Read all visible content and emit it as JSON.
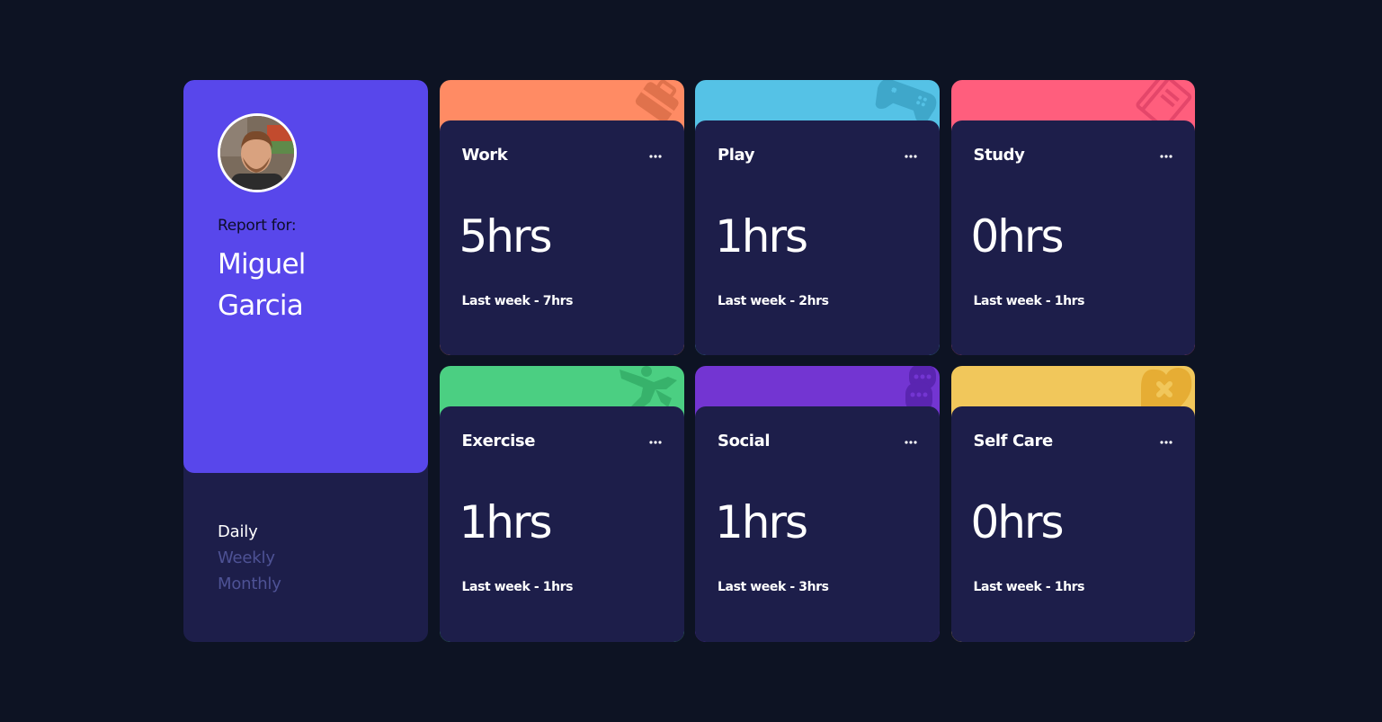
{
  "profile": {
    "report_label": "Report for:",
    "name": "Miguel Garcia",
    "timeframes": [
      "Daily",
      "Weekly",
      "Monthly"
    ],
    "active_timeframe": "Daily"
  },
  "cards": [
    {
      "title": "Work",
      "current": "5hrs",
      "previous": "Last week - 7hrs",
      "color": "#ff8b64",
      "icon": "briefcase-icon"
    },
    {
      "title": "Play",
      "current": "1hrs",
      "previous": "Last week - 2hrs",
      "color": "#55c2e6",
      "icon": "gamepad-icon"
    },
    {
      "title": "Study",
      "current": "0hrs",
      "previous": "Last week - 1hrs",
      "color": "#ff5e7d",
      "icon": "book-icon"
    },
    {
      "title": "Exercise",
      "current": "1hrs",
      "previous": "Last week - 1hrs",
      "color": "#4bcf82",
      "icon": "running-icon"
    },
    {
      "title": "Social",
      "current": "1hrs",
      "previous": "Last week - 3hrs",
      "color": "#7335d2",
      "icon": "bubbles-icon"
    },
    {
      "title": "Self Care",
      "current": "0hrs",
      "previous": "Last week - 1hrs",
      "color": "#f1c75b",
      "icon": "heart-plus-icon"
    }
  ],
  "colors": {
    "background": "#0d1323",
    "card_body": "#1d1e4a",
    "profile_accent": "#5847eb",
    "inactive_text": "#6f76c8"
  }
}
